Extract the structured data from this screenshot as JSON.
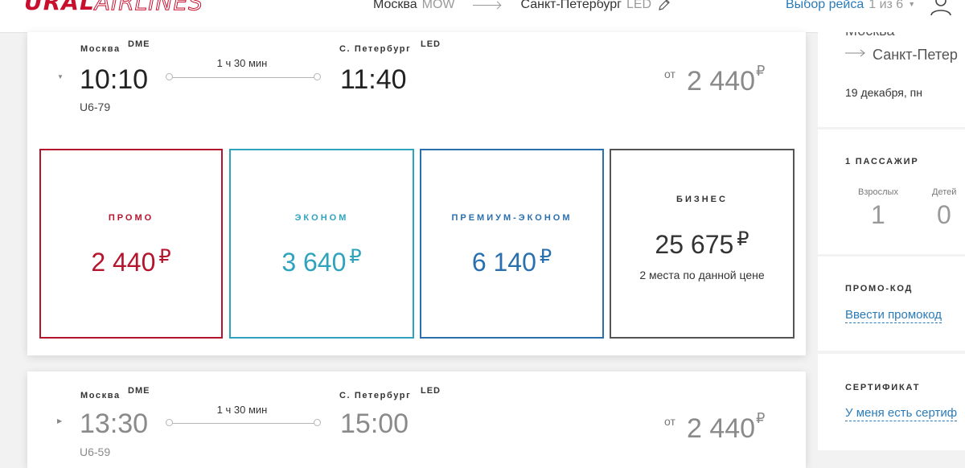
{
  "header": {
    "logo_bold": "URAL",
    "logo_light": "AIRLINES",
    "route": {
      "from_city": "Москва",
      "from_code": "MOW",
      "to_city": "Санкт-Петербург",
      "to_code": "LED"
    },
    "choose_flight_label": "Выбор рейса",
    "choose_flight_count": "1 из 6",
    "icons": [
      "pencil-icon",
      "chevron-down-icon",
      "user-icon"
    ]
  },
  "flights": [
    {
      "from_city": "Москва",
      "from_code": "DME",
      "to_city": "С. Петербург",
      "to_code": "LED",
      "depart_time": "10:10",
      "arrive_time": "11:40",
      "duration": "1 ч 30 мин",
      "flight_number": "U6-79",
      "price_from_label": "от",
      "price_from": "2 440",
      "currency": "₽",
      "expanded": true,
      "fares": [
        {
          "name": "ПРОМО",
          "price": "2 440",
          "color": "#b5142d"
        },
        {
          "name": "ЭКОНОМ",
          "price": "3 640",
          "color": "#2fa3bd"
        },
        {
          "name": "ПРЕМИУМ-ЭКОНОМ",
          "price": "6 140",
          "color": "#2a6fae"
        },
        {
          "name": "БИЗНЕС",
          "price": "25 675",
          "note": "2 места по данной цене",
          "color": "#333333"
        }
      ]
    },
    {
      "from_city": "Москва",
      "from_code": "DME",
      "to_city": "С. Петербург",
      "to_code": "LED",
      "depart_time": "13:30",
      "arrive_time": "15:00",
      "duration": "1 ч 30 мин",
      "flight_number": "U6-59",
      "price_from_label": "от",
      "price_from": "2 440",
      "currency": "₽",
      "expanded": false
    }
  ],
  "sidebar": {
    "from_city": "Москва",
    "to_city": "Санкт-Петер",
    "date": "19 декабря, пн",
    "passengers_title": "1 ПАССАЖИР",
    "adults_label": "Взрослых",
    "adults_count": "1",
    "children_label": "Детей",
    "children_count": "0",
    "promo_title": "ПРОМО-КОД",
    "promo_link": "Ввести промокод",
    "certificate_title": "СЕРТИФИКАТ",
    "certificate_link": "У меня есть сертиф"
  },
  "colors": {
    "brand_red": "#c8102e",
    "link_blue": "#2b7bb9"
  }
}
